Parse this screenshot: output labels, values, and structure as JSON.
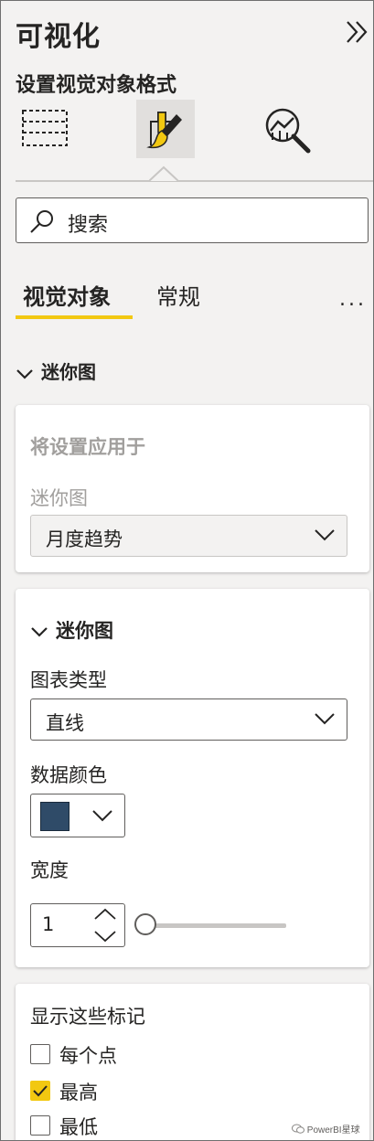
{
  "pane": {
    "title": "可视化",
    "subtitle": "设置视觉对象格式"
  },
  "icons": {
    "collapse": "double-chevron-right-icon",
    "build": "build-visual-icon",
    "format": "format-paintbrush-icon",
    "analytics": "analytics-magnifier-icon"
  },
  "search": {
    "placeholder": "搜索"
  },
  "pivot_tabs": {
    "visual": "视觉对象",
    "general": "常规",
    "more": "..."
  },
  "section": {
    "title": "迷你图"
  },
  "apply_card": {
    "heading": "将设置应用于",
    "field_label": "迷你图",
    "selected": "月度趋势"
  },
  "sparkline_card": {
    "heading": "迷你图",
    "chart_type_label": "图表类型",
    "chart_type_value": "直线",
    "data_color_label": "数据颜色",
    "data_color_value": "#2f4b68",
    "width_label": "宽度",
    "width_value": "1"
  },
  "markers_card": {
    "heading": "显示这些标记",
    "options": [
      {
        "label": "每个点",
        "checked": false
      },
      {
        "label": "最高",
        "checked": true
      },
      {
        "label": "最低",
        "checked": false
      }
    ]
  },
  "watermark": {
    "text": "PowerBI星球"
  },
  "colors": {
    "accent": "#f2c811",
    "selected_tab_bg": "#e1dfdd",
    "pane_bg": "#f3f2f1"
  }
}
